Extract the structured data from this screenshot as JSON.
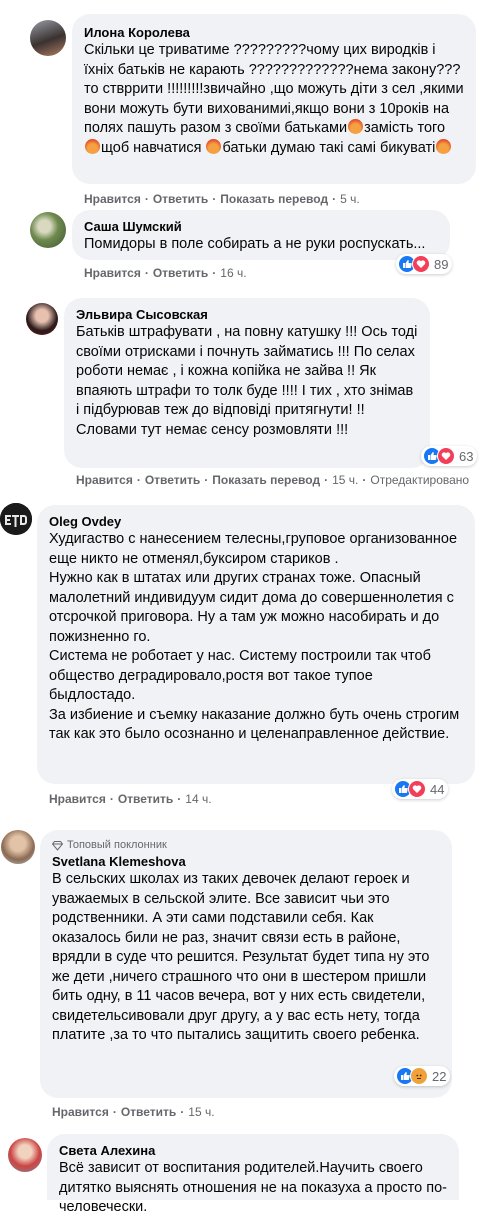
{
  "colors": {
    "bubble_bg": "#f0f2f5",
    "secondary_text": "#65676b",
    "like_blue": "#1877f2",
    "love_red": "#f33e58",
    "angry_orange": "#f0a23a"
  },
  "comments": [
    {
      "author": "Илона Королева",
      "text": "Скільки це триватиме ?????????чому цих виродків і їхніх батьків не карають ?????????????нема закону???то ствррити !!!!!!!!!звичайно ,що можуть діти з сел ,якими вони можуть бути вихованимиі,якщо вони з 10років на полях пашуть разом з своїми батьками",
      "text_tail_1": "замість того",
      "text_tail_2": "щоб навчатися",
      "text_tail_3": "батьки думаю такі самі бикуваті",
      "like": "Нравится",
      "reply": "Ответить",
      "translate": "Показать перевод",
      "time": "5 ч."
    },
    {
      "author": "Саша Шумский",
      "text": "Помидоры в поле собирать а не руки роспускать...",
      "like": "Нравится",
      "reply": "Ответить",
      "time": "16 ч.",
      "reaction_count": "89",
      "reaction_icons": [
        "like-icon",
        "love-icon"
      ]
    },
    {
      "author": "Эльвира Сысовская",
      "text": "Батьків штрафувати , на повну катушку !!! Ось тоді своїми отрисками і почнуть займатись !!! По селах роботи немає , і кожна копійка не зайва !! Як впаяють штрафи то толк буде !!!! І тих , хто знімав і підбурював теж до відповіді притягнути! !! Словами тут немає сенсу розмовляти !!!",
      "like": "Нравится",
      "reply": "Ответить",
      "translate": "Показать перевод",
      "time": "15 ч.",
      "edited": "Отредактировано",
      "reaction_count": "63",
      "reaction_icons": [
        "like-icon",
        "love-icon"
      ]
    },
    {
      "author": "Oleg Ovdey",
      "text": "Худигаство с нанесением телесны,груповое организованное еще никто не отменял,буксиром стариков .\nНужно как в штатах или других странах тоже. Опасный малолетний индивидуум сидит дома до совершеннолетия с отсрочкой приговора. Ну а там уж можно насобирать и до пожизненно го.\nСистема не роботает у нас. Систему построили так чтоб общество деградировало,ростя вот такое тупое быдлостадо.\nЗа избиение и съемку наказание должно буть очень строгим так как это было осознанно и целенаправленное действие.",
      "like": "Нравится",
      "reply": "Ответить",
      "time": "14 ч.",
      "reaction_count": "44",
      "reaction_icons": [
        "like-icon",
        "love-icon"
      ]
    },
    {
      "author": "Svetlana Klemeshova",
      "badge": "Топовый поклонник",
      "text": "В сельских школах из таких девочек делают героек и уважаемых в сельской элите. Все зависит чьи это родственники. А эти сами подставили себя. Как оказалось били не раз, значит связи есть в районе, врядли в суде что решится. Результат будет типа ну это же дети ,ничего страшного что они в шестером пришли бить одну, в 11 часов вечера, вот у них есть свидетели, свидетельсивовали друг другу, а у вас есть нету, тогда платите ,за то что пытались защитить своего ребенка.",
      "like": "Нравится",
      "reply": "Ответить",
      "time": "15 ч.",
      "reaction_count": "22",
      "reaction_icons": [
        "like-icon",
        "angry-icon"
      ]
    },
    {
      "author": "Света Алехина",
      "text": "Всё зависит от воспитания родителей.Научить своего дитятко выяснять отношения не на показуха а просто по-человечески."
    }
  ]
}
